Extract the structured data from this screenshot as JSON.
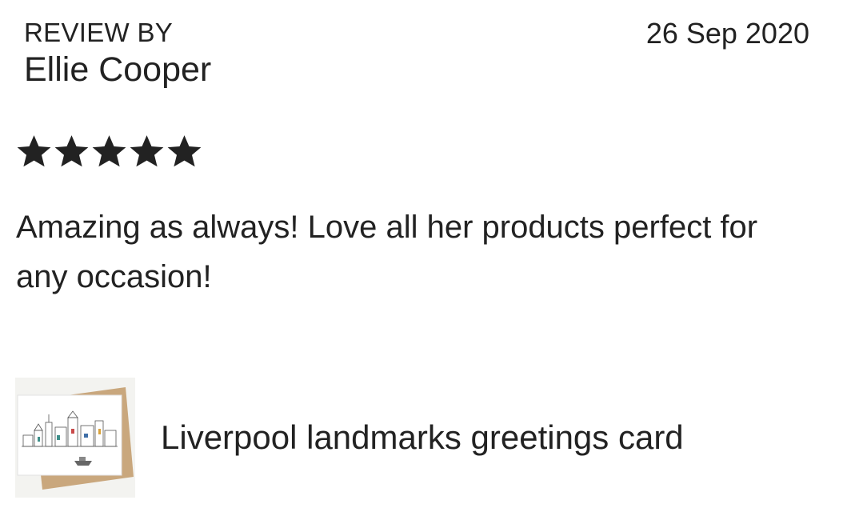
{
  "review": {
    "header_label": "REVIEW BY",
    "reviewer_name": "Ellie Cooper",
    "date": "26 Sep 2020",
    "rating": 5,
    "rating_max": 5,
    "text": "Amazing as always! Love all her products perfect for any occasion!"
  },
  "product": {
    "name": "Liverpool landmarks greetings card",
    "thumbnail_icon": "card-thumbnail"
  },
  "colors": {
    "text": "#222222",
    "star": "#222222",
    "envelope": "#c9a77d",
    "background": "#ffffff"
  }
}
